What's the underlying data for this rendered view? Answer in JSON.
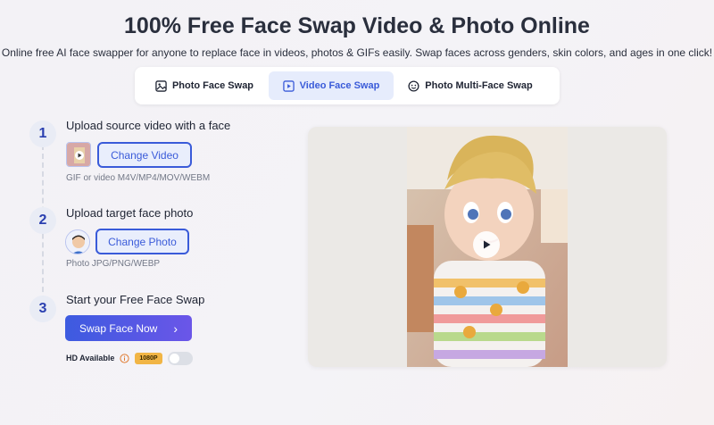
{
  "header": {
    "title": "100% Free Face Swap Video & Photo Online",
    "subtitle": "Online free AI face swapper for anyone to replace face in videos, photos & GIFs easily. Swap faces across genders, skin colors, and ages in one click!"
  },
  "tabs": [
    {
      "label": "Photo Face Swap",
      "icon": "image-icon",
      "active": false
    },
    {
      "label": "Video Face Swap",
      "icon": "video-icon",
      "active": true
    },
    {
      "label": "Photo Multi-Face Swap",
      "icon": "multi-face-icon",
      "active": false
    }
  ],
  "steps": [
    {
      "number": "1",
      "title": "Upload source video with a face",
      "button": "Change Video",
      "hint": "GIF or video M4V/MP4/MOV/WEBM"
    },
    {
      "number": "2",
      "title": "Upload target face photo",
      "button": "Change Photo",
      "hint": "Photo JPG/PNG/WEBP"
    },
    {
      "number": "3",
      "title": "Start your Free Face Swap",
      "button": "Swap Face Now"
    }
  ],
  "hd": {
    "label": "HD Available",
    "badge": "1080P",
    "enabled": false
  },
  "colors": {
    "accent": "#3a5bd9",
    "badge": "#f1b545",
    "active_tab_bg": "#e6ecfc"
  }
}
